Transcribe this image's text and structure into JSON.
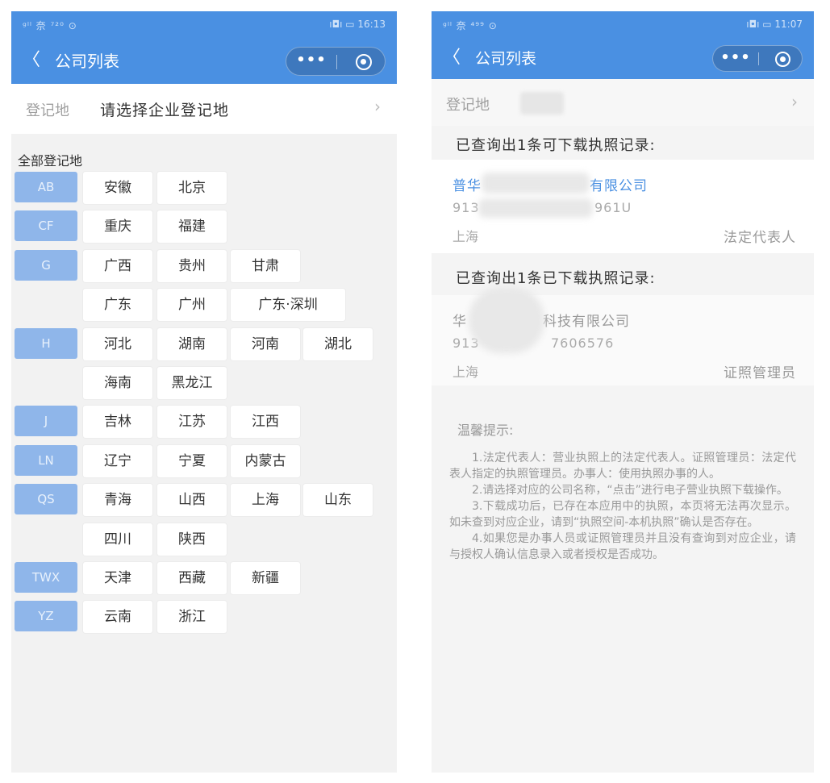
{
  "left": {
    "status": {
      "left": "ᵍˡˡ 奈 ⁷²⁰ ⊙",
      "right": "ı◘ı ▭ 16:13"
    },
    "nav": {
      "back": "〈",
      "title": "公司列表",
      "dots": "•••"
    },
    "region_row": {
      "label": "登记地",
      "value": "请选择企业登记地",
      "chevron": "›"
    },
    "section_title": "全部登记地",
    "groups": [
      {
        "letter": "AB",
        "rows": [
          [
            "安徽",
            "北京"
          ]
        ]
      },
      {
        "letter": "CF",
        "rows": [
          [
            "重庆",
            "福建"
          ]
        ]
      },
      {
        "letter": "G",
        "rows": [
          [
            "广西",
            "贵州",
            "甘肃"
          ],
          [
            "广东",
            "广州",
            "广东·深圳"
          ]
        ]
      },
      {
        "letter": "H",
        "rows": [
          [
            "河北",
            "湖南",
            "河南",
            "湖北"
          ],
          [
            "海南",
            "黑龙江"
          ]
        ]
      },
      {
        "letter": "J",
        "rows": [
          [
            "吉林",
            "江苏",
            "江西"
          ]
        ]
      },
      {
        "letter": "LN",
        "rows": [
          [
            "辽宁",
            "宁夏",
            "内蒙古"
          ]
        ]
      },
      {
        "letter": "QS",
        "rows": [
          [
            "青海",
            "山西",
            "上海",
            "山东"
          ],
          [
            "四川",
            "陕西"
          ]
        ]
      },
      {
        "letter": "TWX",
        "rows": [
          [
            "天津",
            "西藏",
            "新疆"
          ]
        ]
      },
      {
        "letter": "YZ",
        "rows": [
          [
            "云南",
            "浙江"
          ]
        ]
      }
    ]
  },
  "right": {
    "status": {
      "left": "ᵍˡˡ 奈 ⁴⁹⁹ ⊙",
      "right": "ı◘ı ▭ 11:07"
    },
    "nav": {
      "back": "〈",
      "title": "公司列表",
      "dots": "•••"
    },
    "region_row": {
      "label": "登记地",
      "chevron": "›"
    },
    "downloadable": {
      "title": "已查询出1条可下载执照记录:",
      "name_a": "普华",
      "name_b": "有限公司",
      "code_a": "913",
      "code_b": "961U",
      "location": "上海",
      "role": "法定代表人",
      "accent": "#4a90e2"
    },
    "downloaded": {
      "title": "已查询出1条已下载执照记录:",
      "name_a": "华",
      "name_b": "科技有限公司",
      "code_a": "913",
      "code_b": "7606576",
      "location": "上海",
      "role": "证照管理员"
    },
    "tips": {
      "title": "温馨提示:",
      "items": [
        "1.法定代表人：营业执照上的法定代表人。证照管理员：法定代表人指定的执照管理员。办事人：使用执照办事的人。",
        "2.请选择对应的公司名称，“点击”进行电子营业执照下载操作。",
        "3.下载成功后，已存在本应用中的执照，本页将无法再次显示。如未查到对应企业，请到“执照空间-本机执照”确认是否存在。",
        "4.如果您是办事人员或证照管理员并且没有查询到对应企业，请与授权人确认信息录入或者授权是否成功。"
      ]
    }
  }
}
